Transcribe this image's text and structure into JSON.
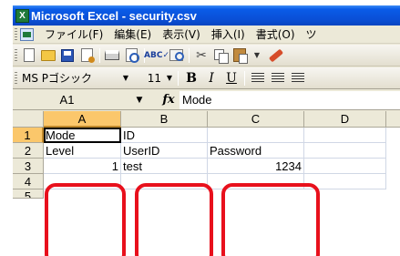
{
  "window": {
    "title": "Microsoft Excel - security.csv",
    "app_icon_letter": "X"
  },
  "menu": [
    "ファイル(F)",
    "編集(E)",
    "表示(V)",
    "挿入(I)",
    "書式(O)",
    "ツ"
  ],
  "formatting": {
    "font_name": "MS Pゴシック",
    "font_size": "11",
    "bold_label": "B",
    "italic_label": "I",
    "underline_label": "U"
  },
  "formula_bar": {
    "name_box": "A1",
    "fx_label": "fx",
    "content": "Mode"
  },
  "sheet": {
    "columns": [
      "A",
      "B",
      "C",
      "D"
    ],
    "rows": [
      "1",
      "2",
      "3",
      "4",
      "5"
    ],
    "cells": {
      "A1": "Mode",
      "B1": "ID",
      "A2": "Level",
      "B2": "UserID",
      "C2": "Password",
      "A3": "1",
      "B3": "test",
      "C3": "1234"
    },
    "selected_cell": "A1"
  },
  "annotation": {
    "highlight_color": "#e8101c"
  }
}
